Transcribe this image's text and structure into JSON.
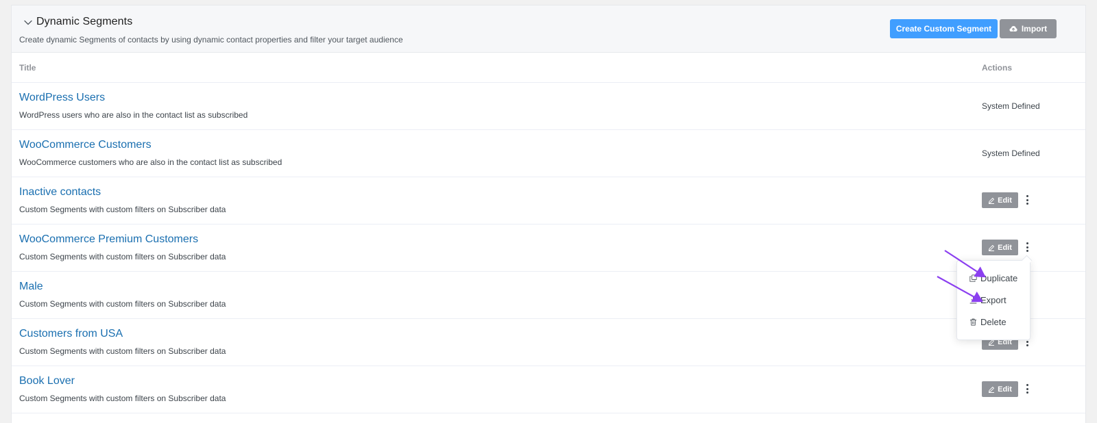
{
  "header": {
    "title": "Dynamic Segments",
    "subtitle": "Create dynamic Segments of contacts by using dynamic contact properties and filter your target audience",
    "create_label": "Create Custom Segment",
    "import_label": "Import"
  },
  "table": {
    "col_title": "Title",
    "col_actions": "Actions",
    "edit_label": "Edit",
    "rows": [
      {
        "title": "WordPress Users",
        "desc": "WordPress users who are also in the contact list as subscribed",
        "status": "System Defined"
      },
      {
        "title": "WooCommerce Customers",
        "desc": "WooCommerce customers who are also in the contact list as subscribed",
        "status": "System Defined"
      },
      {
        "title": "Inactive contacts",
        "desc": "Custom Segments with custom filters on Subscriber data"
      },
      {
        "title": "WooCommerce Premium Customers",
        "desc": "Custom Segments with custom filters on Subscriber data"
      },
      {
        "title": "Male",
        "desc": "Custom Segments with custom filters on Subscriber data"
      },
      {
        "title": "Customers from USA",
        "desc": "Custom Segments with custom filters on Subscriber data"
      },
      {
        "title": "Book Lover",
        "desc": "Custom Segments with custom filters on Subscriber data"
      }
    ]
  },
  "dropdown": {
    "duplicate_label": "Duplicate",
    "export_label": "Export",
    "delete_label": "Delete"
  },
  "colors": {
    "primary": "#409eff",
    "secondary": "#909399",
    "link": "#1a6fb0",
    "annotation_arrow": "#8b3ff0"
  },
  "icons": {
    "collapse": "chevron-down-icon",
    "import": "cloud-upload-icon",
    "edit": "pencil-icon",
    "more": "kebab-menu-icon",
    "duplicate": "copy-icon",
    "export": "download-icon",
    "delete": "trash-icon"
  }
}
